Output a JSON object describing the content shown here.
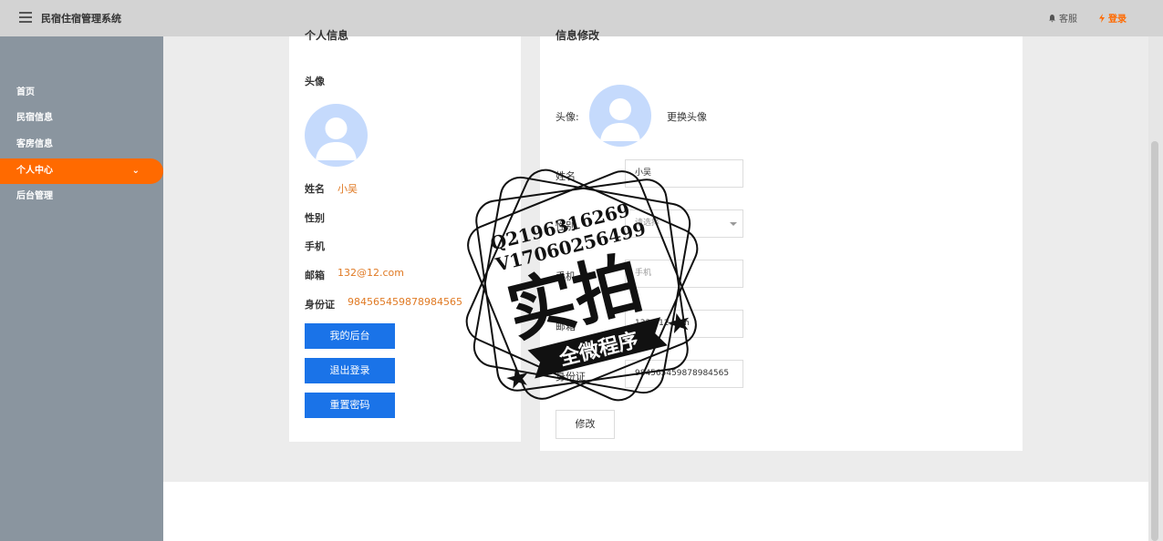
{
  "header": {
    "app_title": "民宿住宿管理系统",
    "service_label": "客服",
    "login_label": "登录"
  },
  "sidebar": {
    "items": [
      {
        "label": "首页"
      },
      {
        "label": "民宿信息"
      },
      {
        "label": "客房信息"
      },
      {
        "label": "个人中心",
        "active": true
      },
      {
        "label": "后台管理"
      }
    ]
  },
  "profile": {
    "title_cut": "个人信息",
    "avatar_label": "头像",
    "name_label": "姓名",
    "name_value": "小吴",
    "gender_label": "性别",
    "phone_label": "手机",
    "email_label": "邮箱",
    "email_value": "132@12.com",
    "id_label": "身份证",
    "id_value": "984565459878984565",
    "buttons": {
      "backend": "我的后台",
      "logout": "退出登录",
      "reset_password": "重置密码"
    }
  },
  "edit": {
    "title_cut": "信息修改",
    "avatar_label": "头像:",
    "change_avatar": "更换头像",
    "name_label": "姓名",
    "name_value": "小吴",
    "gender_label": "性别",
    "gender_placeholder": "请选择",
    "phone_label": "手机",
    "phone_placeholder": "手机",
    "email_label": "邮箱",
    "email_value": "132@12.com",
    "id_label": "身份证",
    "id_value": "984565459878984565",
    "submit_label": "修改"
  },
  "watermark": {
    "line1": "Q2196316269",
    "line2": "V17060256499",
    "main": "实拍",
    "banner": "全微程序"
  },
  "colors": {
    "accent": "#ff6a00",
    "primary_button": "#1a73e8",
    "sidebar_bg": "#8a959f",
    "value_text": "#e07a24"
  }
}
